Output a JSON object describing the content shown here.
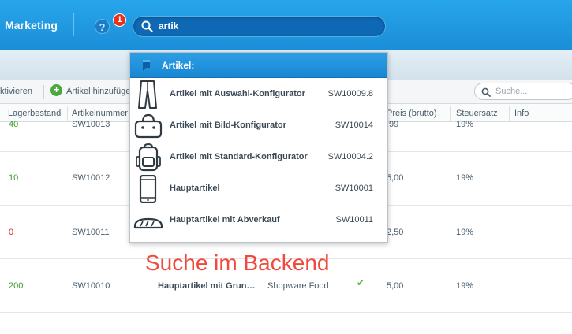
{
  "topbar": {
    "menu_marketing": "Marketing",
    "help_icon": "?",
    "notification_count": "1",
    "search_value": "artik"
  },
  "toolbar": {
    "activate_label": "ktivieren",
    "add_icon": "+",
    "add_label": "Artikel hinzufüge",
    "search_placeholder": "Suche..."
  },
  "grid": {
    "columns": [
      "Lagerbestand",
      "Artikelnummer",
      "Preis (brutto)",
      "Steuersatz",
      "Info"
    ],
    "rows": [
      {
        "stock": "40",
        "number": "SW10013",
        "price": ",99",
        "tax": "19%"
      },
      {
        "stock": "10",
        "number": "SW10012",
        "price": "5,00",
        "tax": "19%"
      },
      {
        "stock": "0",
        "number": "SW10011",
        "price": "2,50",
        "tax": "19%"
      },
      {
        "stock": "200",
        "number": "SW10010",
        "name": "Hauptartikel mit Grun…",
        "supplier": "Shopware Food",
        "active": "✔",
        "price": "5,00",
        "tax": "19%"
      }
    ]
  },
  "dropdown": {
    "title": "Artikel:",
    "items": [
      {
        "name": "Artikel mit Auswahl-Konfigurator",
        "number": "SW10009.8",
        "icon": "trousers-icon"
      },
      {
        "name": "Artikel mit Bild-Konfigurator",
        "number": "SW10014",
        "icon": "bag-icon"
      },
      {
        "name": "Artikel mit Standard-Konfigurator",
        "number": "SW10004.2",
        "icon": "backpack-icon"
      },
      {
        "name": "Hauptartikel",
        "number": "SW10001",
        "icon": "phone-icon"
      },
      {
        "name": "Hauptartikel mit Abverkauf",
        "number": "SW10011",
        "icon": "bread-icon"
      }
    ]
  },
  "annotation": "Suche im Backend",
  "colors": {
    "topbar": "#1b8ed8",
    "badge": "#e8321e",
    "annotation": "#f04a3e",
    "stock_green": "#3a9b2a",
    "stock_red": "#d8281c"
  }
}
